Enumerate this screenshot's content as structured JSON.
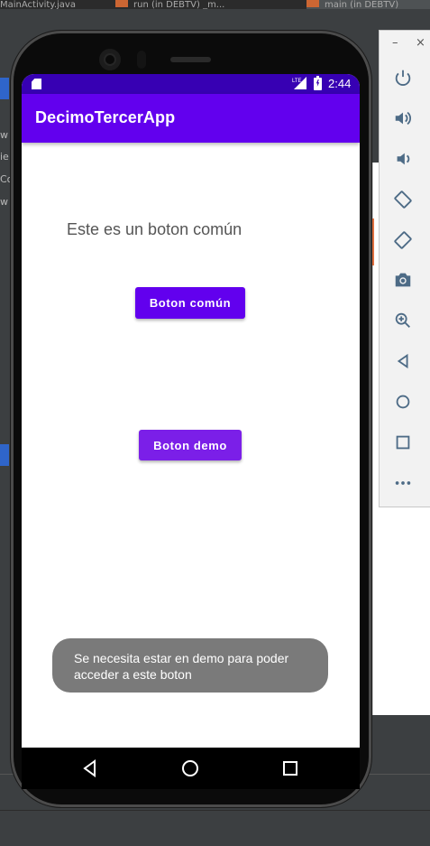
{
  "ide": {
    "tabs": [
      "MainActivity.java",
      "run (in DEBTV) _m...",
      "main (in DEBTV)"
    ],
    "left_fragments": [
      "w",
      "ie",
      "Co",
      "w"
    ]
  },
  "emulator_toolbar": {
    "minimize_label": "–",
    "close_label": "×",
    "tools": [
      "power-icon",
      "volume-up-icon",
      "volume-down-icon",
      "rotate-left-icon",
      "rotate-right-icon",
      "camera-icon",
      "zoom-icon",
      "back-icon",
      "home-icon",
      "overview-icon",
      "more-icon"
    ]
  },
  "status_bar": {
    "network": "LTE",
    "time": "2:44"
  },
  "app": {
    "title": "DecimoTercerApp",
    "label": "Este es un boton común",
    "button_common": "Boton común",
    "button_demo": "Boton demo",
    "toast": "Se necesita estar en demo para poder acceder a este boton"
  },
  "colors": {
    "status_bar": "#3700b3",
    "app_bar": "#6200ee",
    "button_common": "#6200ee",
    "button_demo": "#7b1fe8",
    "toast": "#7a7a7a"
  }
}
